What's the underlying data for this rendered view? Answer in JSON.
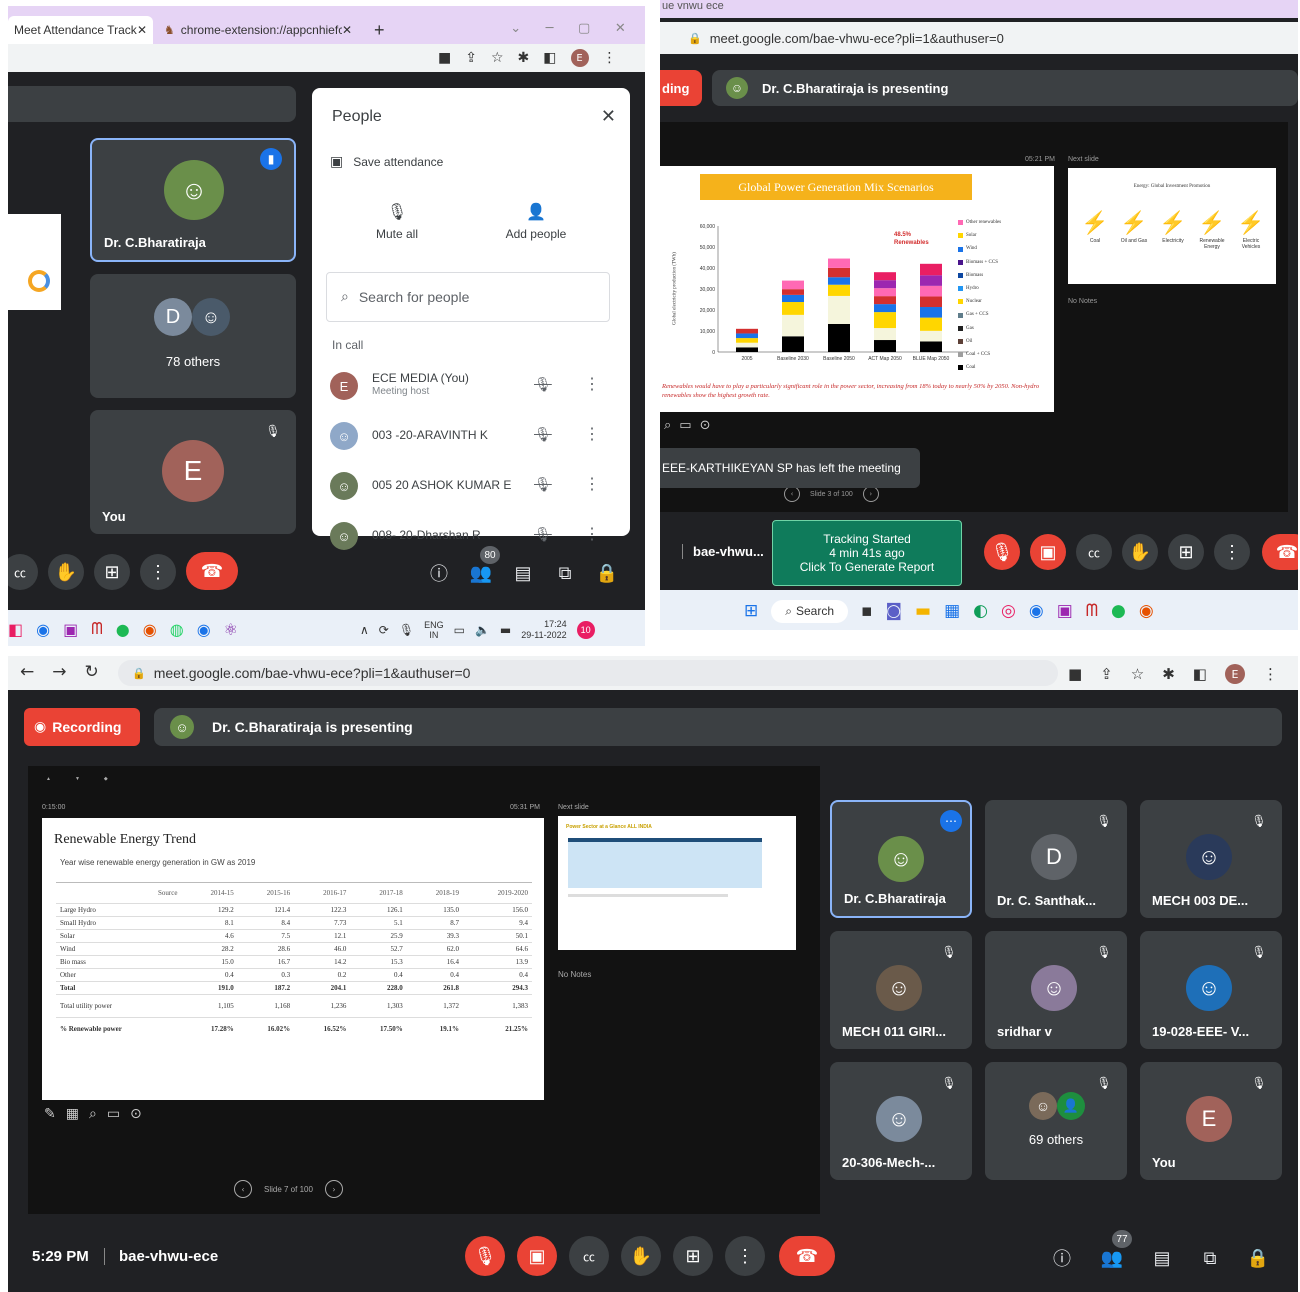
{
  "p1": {
    "tabs": [
      {
        "label": "Meet Attendance Tracke"
      },
      {
        "label": "chrome-extension://appcnhiefc"
      }
    ],
    "new_tab": "+",
    "people": {
      "title": "People",
      "save_attendance": "Save attendance",
      "mute_all": "Mute all",
      "add_people": "Add people",
      "search_placeholder": "Search for people",
      "in_call": "In call",
      "participants": [
        {
          "name": "ECE MEDIA (You)",
          "sub": "Meeting host",
          "initial": "E"
        },
        {
          "name": "003 -20-ARAVINTH K",
          "sub": ""
        },
        {
          "name": "005 20 ASHOK KUMAR E",
          "sub": ""
        },
        {
          "name": "008- 20-Dharshan R",
          "sub": ""
        }
      ]
    },
    "tiles": {
      "presenter": "Dr. C.Bharatiraja",
      "others": "78 others",
      "others_initial": "D",
      "you": "You",
      "you_initial": "E"
    },
    "people_count": "80",
    "taskbar": {
      "lang1": "ENG",
      "lang2": "IN",
      "time": "17:24",
      "date": "29-11-2022",
      "badge": "10",
      "chat_badge": "80"
    }
  },
  "p2": {
    "url": "meet.google.com/bae-vhwu-ece?pli=1&authuser=0",
    "top_tabs": "ue vnwu ece",
    "recording": "ding",
    "presenting": "Dr. C.Bharatiraja is presenting",
    "slide": {
      "title": "Global Power Generation Mix Scenarios",
      "annotation_pct": "48.5%",
      "annotation_label": "Renewables",
      "caption": "Renewables would have to play a particularly significant role in the power sector, increasing from 18% today to nearly 50% by 2050. Non-hydro renewables show the highest growth rate.",
      "time": "05:21 PM",
      "next_slide_label": "Next slide",
      "next_title": "Energy: Global Investment Promotion",
      "next_items": [
        "Coal",
        "Oil and Gas",
        "Electricity",
        "Renewable Energy",
        "Electric Vehicles"
      ],
      "no_notes": "No Notes",
      "slide_counter": "Slide 3 of 100"
    },
    "chart_data": {
      "type": "bar",
      "ylabel": "Global electricity production (TWh)",
      "categories": [
        "2005",
        "Baseline 2030",
        "Baseline 2050",
        "ACT Map 2050",
        "BLUE Map 2050"
      ],
      "ylim": [
        0,
        60000
      ],
      "yticks": [
        "0",
        "10,000",
        "20,000",
        "30,000",
        "40,000",
        "50,000",
        "60,000"
      ],
      "legend": [
        "Other renewables",
        "Solar",
        "Wind",
        "Biomass + CCS",
        "Biomass",
        "Hydro",
        "Nuclear",
        "Gas + CCS",
        "Gas",
        "Oil",
        "Coal + CCS",
        "Coal"
      ]
    },
    "toast": "EEE-KARTHIKEYAN SP has left the meeting",
    "meeting_code": "bae-vhwu...",
    "tracking": {
      "line1": "Tracking Started",
      "line2": "4 min 41s ago",
      "line3": "Click To Generate Report"
    },
    "taskbar_search": "Search"
  },
  "p3": {
    "url": "meet.google.com/bae-vhwu-ece?pli=1&authuser=0",
    "recording": "Recording",
    "presenting": "Dr. C.Bharatiraja is presenting",
    "slide": {
      "time_left": "0:15:00",
      "time_right": "05:31 PM",
      "next_slide_label": "Next slide",
      "title": "Renewable Energy Trend",
      "subtitle": "Year wise renewable energy generation in GW as 2019",
      "next_title": "Power Sector at a Glance ALL INDIA",
      "no_notes": "No Notes",
      "slide_counter": "Slide 7 of 100",
      "columns": [
        "Source",
        "2014-15",
        "2015-16",
        "2016-17",
        "2017-18",
        "2018-19",
        "2019-2020"
      ],
      "rows": [
        [
          "Large Hydro",
          "129.2",
          "121.4",
          "122.3",
          "126.1",
          "135.0",
          "156.0"
        ],
        [
          "Small Hydro",
          "8.1",
          "8.4",
          "7.73",
          "5.1",
          "8.7",
          "9.4"
        ],
        [
          "Solar",
          "4.6",
          "7.5",
          "12.1",
          "25.9",
          "39.3",
          "50.1"
        ],
        [
          "Wind",
          "28.2",
          "28.6",
          "46.0",
          "52.7",
          "62.0",
          "64.6"
        ],
        [
          "Bio mass",
          "15.0",
          "16.7",
          "14.2",
          "15.3",
          "16.4",
          "13.9"
        ],
        [
          "Other",
          "0.4",
          "0.3",
          "0.2",
          "0.4",
          "0.4",
          "0.4"
        ],
        [
          "Total",
          "191.0",
          "187.2",
          "204.1",
          "228.0",
          "261.8",
          "294.3"
        ],
        [
          "Total utility power",
          "1,105",
          "1,168",
          "1,236",
          "1,303",
          "1,372",
          "1,383"
        ],
        [
          "% Renewable power",
          "17.28%",
          "16.02%",
          "16.52%",
          "17.50%",
          "19.1%",
          "21.25%"
        ]
      ]
    },
    "tiles": [
      {
        "name": "Dr. C.Bharatiraja",
        "type": "photo",
        "active": true
      },
      {
        "name": "Dr. C. Santhak...",
        "type": "initial",
        "initial": "D",
        "color": "#5f6368"
      },
      {
        "name": "MECH 003 DE...",
        "type": "photo"
      },
      {
        "name": "MECH 011 GIRI...",
        "type": "photo"
      },
      {
        "name": "sridhar v",
        "type": "photo"
      },
      {
        "name": "19-028-EEE- V...",
        "type": "photo"
      },
      {
        "name": "20-306-Mech-...",
        "type": "photo"
      },
      {
        "name": "69 others",
        "type": "group"
      },
      {
        "name": "You",
        "type": "initial",
        "initial": "E",
        "color": "#a1625a"
      }
    ],
    "time": "5:29 PM",
    "meeting_code": "bae-vhwu-ece",
    "people_count": "77"
  },
  "colors": {
    "meet_bg": "#202124",
    "tile_bg": "#3c4043",
    "red": "#ea4335",
    "blue_outline": "#8ab4f8",
    "tracking_green": "#0f7b5b"
  }
}
